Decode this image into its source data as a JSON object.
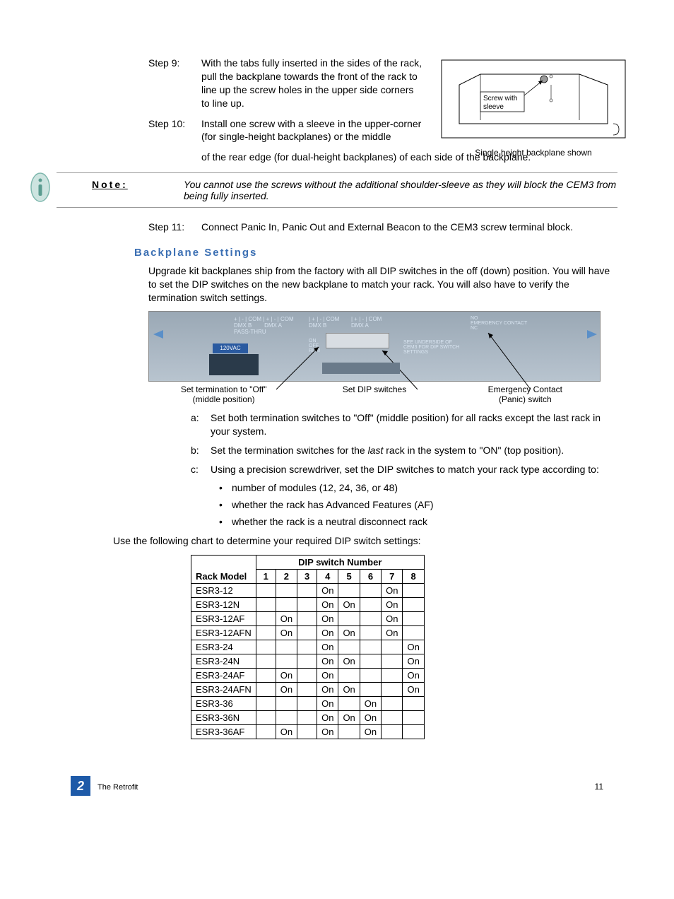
{
  "steps": {
    "s9_label": "Step 9:",
    "s9_text": "With the tabs fully inserted in the sides of the rack, pull the backplane towards the front of the rack to line up the screw holes in the upper side corners to line up.",
    "s10_label": "Step 10:",
    "s10_text": "Install one screw with a sleeve in the upper-corner (for single-height backplanes) or the middle of the rear edge (for dual-height backplanes) of each side of the backplane.",
    "s11_label": "Step 11:",
    "s11_text": "Connect Panic In, Panic Out and External Beacon to the CEM3 screw terminal block."
  },
  "figure1": {
    "screw_label": "Screw with sleeve",
    "caption": "Single height backplane shown"
  },
  "note": {
    "label": "Note:",
    "text": "You cannot use the screws without the additional shoulder-sleeve as they will block the CEM3 from being fully inserted."
  },
  "section_header": "Backplane Settings",
  "bp_intro": "Upgrade kit backplanes ship from the factory with all DIP switches in the off (down) position. You will have to set the DIP switches on the new backplane to match your rack. You will also have to verify the termination switch settings.",
  "bp_fig_labels": {
    "dmxb_passthru": "+ | - | COM | + | - | COM\nDMX B        DMX A\nPASS-THRU",
    "dmxb": "| + | - | COM\nDMX B",
    "dmxa": "| + | - | COM\nDMX A",
    "onoffrdm": "ON\nOFF\nRDM",
    "underside": "SEE UNDERSIDE OF\nCEM3 FOR DIP SWITCH\nSETTINGS",
    "emergency": "NO\nEMERGENCY CONTACT\nNC",
    "v120": "120VAC"
  },
  "bp_captions": {
    "c1a": "Set termination to \"Off\"",
    "c1b": "(middle position)",
    "c2": "Set DIP switches",
    "c3a": "Emergency Contact",
    "c3b": "(Panic) switch"
  },
  "sublist": {
    "a_label": "a:",
    "a_text": "Set both termination switches to \"Off\" (middle position) for all racks except the last rack in your system.",
    "b_label": "b:",
    "b_text_pre": "Set the termination switches for the ",
    "b_text_italic": "last",
    "b_text_post": " rack in the system to \"ON\" (top position).",
    "c_label": "c:",
    "c_text": "Using a precision screwdriver, set the DIP switches to match your rack type according to:"
  },
  "bullets": {
    "b1": "number of modules (12, 24, 36, or 48)",
    "b2": "whether the rack has Advanced Features (AF)",
    "b3": "whether the rack is a neutral disconnect rack"
  },
  "use_chart": "Use the following chart to determine your required DIP switch settings:",
  "table": {
    "header_span": "DIP switch Number",
    "rack_model_hdr": "Rack Model",
    "cols": [
      "1",
      "2",
      "3",
      "4",
      "5",
      "6",
      "7",
      "8"
    ],
    "rows": [
      {
        "model": "ESR3-12",
        "c": [
          "",
          "",
          "",
          "On",
          "",
          "",
          "On",
          ""
        ]
      },
      {
        "model": "ESR3-12N",
        "c": [
          "",
          "",
          "",
          "On",
          "On",
          "",
          "On",
          ""
        ]
      },
      {
        "model": "ESR3-12AF",
        "c": [
          "",
          "On",
          "",
          "On",
          "",
          "",
          "On",
          ""
        ]
      },
      {
        "model": "ESR3-12AFN",
        "c": [
          "",
          "On",
          "",
          "On",
          "On",
          "",
          "On",
          ""
        ]
      },
      {
        "model": "ESR3-24",
        "c": [
          "",
          "",
          "",
          "On",
          "",
          "",
          "",
          "On"
        ]
      },
      {
        "model": "ESR3-24N",
        "c": [
          "",
          "",
          "",
          "On",
          "On",
          "",
          "",
          "On"
        ]
      },
      {
        "model": "ESR3-24AF",
        "c": [
          "",
          "On",
          "",
          "On",
          "",
          "",
          "",
          "On"
        ]
      },
      {
        "model": "ESR3-24AFN",
        "c": [
          "",
          "On",
          "",
          "On",
          "On",
          "",
          "",
          "On"
        ]
      },
      {
        "model": "ESR3-36",
        "c": [
          "",
          "",
          "",
          "On",
          "",
          "On",
          "",
          ""
        ]
      },
      {
        "model": "ESR3-36N",
        "c": [
          "",
          "",
          "",
          "On",
          "On",
          "On",
          "",
          ""
        ]
      },
      {
        "model": "ESR3-36AF",
        "c": [
          "",
          "On",
          "",
          "On",
          "",
          "On",
          "",
          ""
        ]
      }
    ]
  },
  "footer": {
    "chapter_num": "2",
    "chapter_title": "The Retrofit",
    "page": "11"
  }
}
